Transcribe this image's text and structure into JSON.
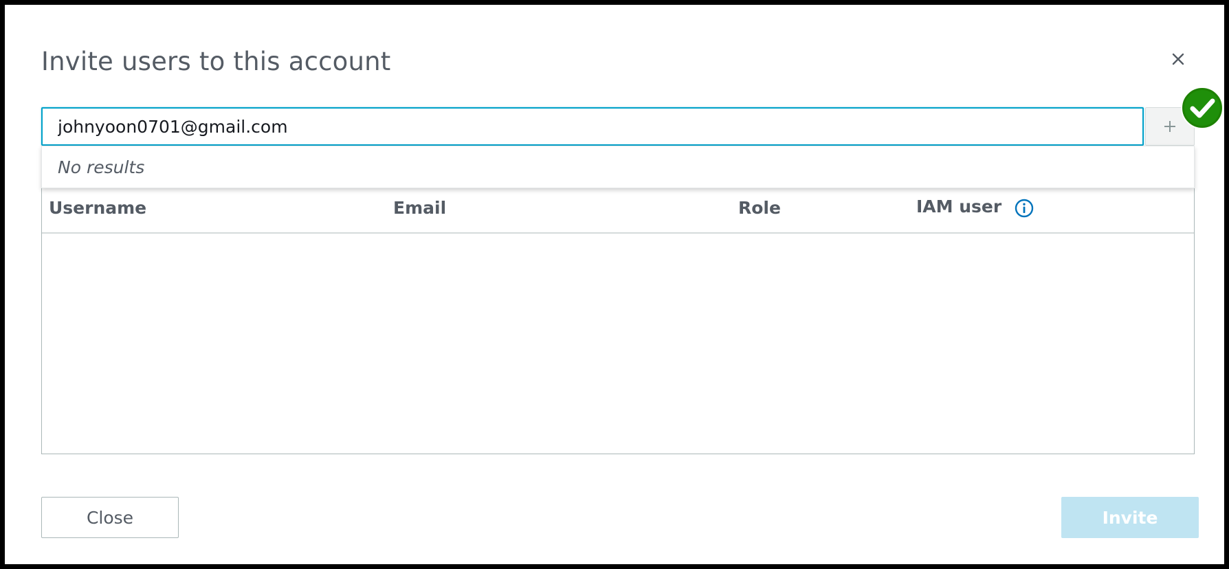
{
  "dialog": {
    "title": "Invite users to this account"
  },
  "invite_input": {
    "value": "johnyoon0701@gmail.com",
    "add_button_icon": "plus-icon"
  },
  "status_badge": {
    "icon": "check-circle-icon",
    "color": "#1d8102"
  },
  "dropdown": {
    "message": "No results"
  },
  "table": {
    "columns": [
      "Username",
      "Email",
      "Role",
      "IAM user"
    ],
    "info_icon": "info-icon",
    "rows": []
  },
  "footer": {
    "close_label": "Close",
    "invite_label": "Invite"
  },
  "colors": {
    "accent": "#00a1c9",
    "invite_disabled": "#bfe4f2",
    "text": "#545b64",
    "success": "#1d8102"
  }
}
